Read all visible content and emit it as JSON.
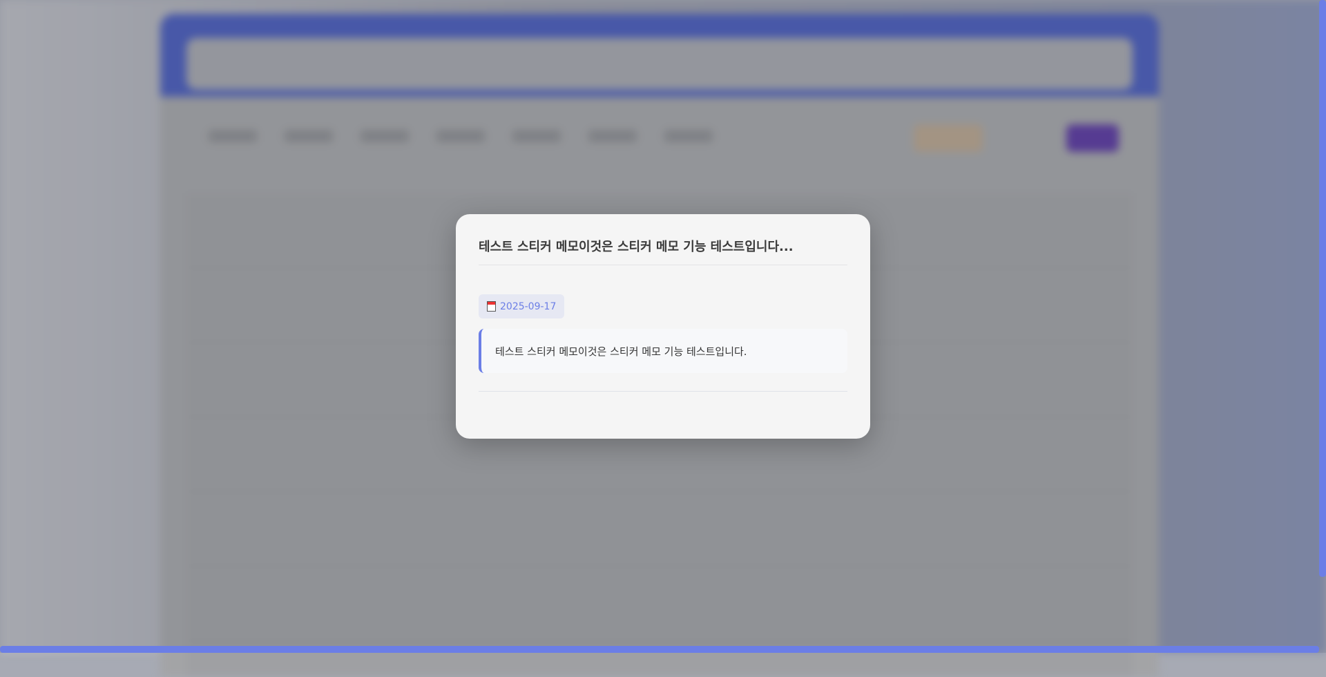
{
  "modal": {
    "title": "테스트 스티커 메모이것은 스티커 메모 기능 테스트입니다...",
    "date": "2025-09-17",
    "date_icon": "calendar-icon",
    "content": "테스트 스티커 메모이것은 스티커 메모 기능 테스트입니다."
  },
  "colors": {
    "accent": "#6b7ee6",
    "header": "#4a5cb8"
  }
}
